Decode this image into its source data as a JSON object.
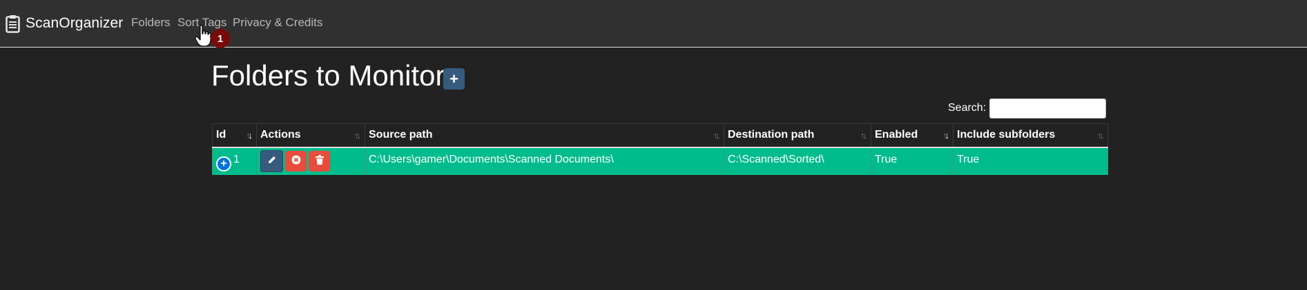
{
  "navbar": {
    "brand": "ScanOrganizer",
    "links": [
      "Folders",
      "Sort Tags",
      "Privacy & Credits"
    ],
    "badge": "1"
  },
  "page": {
    "title": "Folders to Monitor",
    "add_button": "+"
  },
  "search": {
    "label": "Search:",
    "value": ""
  },
  "table": {
    "columns": [
      "Id",
      "Actions",
      "Source path",
      "Destination path",
      "Enabled",
      "Include subfolders"
    ],
    "sorted_column": "Id",
    "rows": [
      {
        "id": "1",
        "source_path": "C:\\Users\\gamer\\Documents\\Scanned Documents\\",
        "destination_path": "C:\\Scanned\\Sorted\\",
        "enabled": "True",
        "include_subfolders": "True"
      }
    ]
  },
  "colors": {
    "background": "#222222",
    "navbar": "#303030",
    "row_highlight": "#00bc8c",
    "primary": "#375a7f",
    "danger": "#e74c3c",
    "badge": "#7a0a0a"
  },
  "icons": [
    "clipboard-icon",
    "hand-pointer-icon",
    "plus-icon",
    "pencil-icon",
    "times-circle-icon",
    "trash-icon",
    "sort-icon"
  ]
}
